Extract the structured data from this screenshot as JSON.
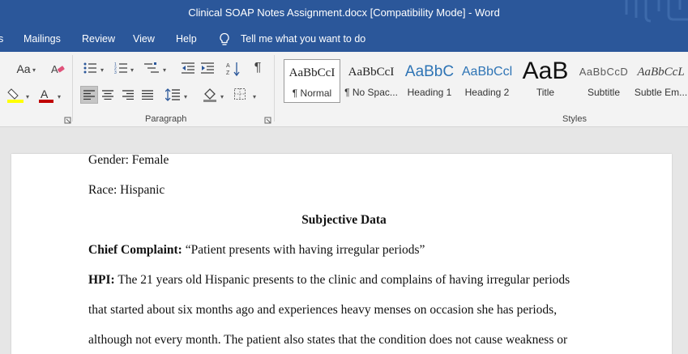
{
  "window": {
    "title": "Clinical SOAP Notes Assignment.docx [Compatibility Mode]  -  Word"
  },
  "menu": {
    "items": [
      {
        "label": "s"
      },
      {
        "label": "Mailings"
      },
      {
        "label": "Review"
      },
      {
        "label": "View"
      },
      {
        "label": "Help"
      }
    ],
    "tell_me": "Tell me what you want to do"
  },
  "ribbon": {
    "font_case_label": "Aa",
    "paragraph_label": "Paragraph",
    "styles_label": "Styles",
    "styles": [
      {
        "sample": "AaBbCcI",
        "label": "¶ Normal",
        "color": "#222222"
      },
      {
        "sample": "AaBbCcI",
        "label": "¶ No Spac...",
        "color": "#222222"
      },
      {
        "sample": "AaBbC",
        "label": "Heading 1",
        "color": "#2e74b5"
      },
      {
        "sample": "AaBbCcl",
        "label": "Heading 2",
        "color": "#2e74b5"
      },
      {
        "sample": "AaB",
        "label": "Title",
        "color": "#111111"
      },
      {
        "sample": "AaBbCcD",
        "label": "Subtitle",
        "color": "#5a5a5a"
      },
      {
        "sample": "AaBbCcL",
        "label": "Subtle Em...",
        "color": "#404040"
      }
    ],
    "colors": {
      "accent": "#2b579a",
      "highlight": "#ffff00",
      "font_color": "#c00000"
    }
  },
  "document": {
    "gender": "Gender: Female",
    "race": "Race: Hispanic",
    "section_title": "Subjective Data",
    "chief_complaint_label": "Chief Complaint:",
    "chief_complaint_text": " “Patient presents with having irregular periods”",
    "hpi_label": "HPI:",
    "hpi_line1": " The 21 years old Hispanic presents to the clinic and complains of having irregular periods",
    "hpi_line2": "that started about six months ago and experiences heavy menses on occasion she has periods,",
    "hpi_line3": "although not every month. The patient also states that the condition does not cause weakness or"
  }
}
